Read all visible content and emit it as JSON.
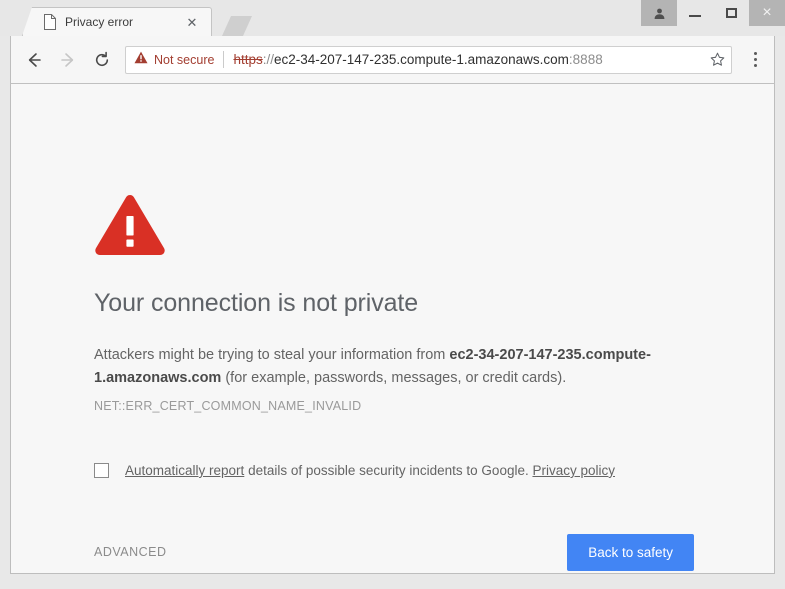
{
  "window": {
    "controls": {
      "avatar_label": "profile-avatar",
      "minimize_label": "Minimize",
      "maximize_label": "Maximize",
      "close_label": "×"
    }
  },
  "tabstrip": {
    "tabs": [
      {
        "title": "Privacy error",
        "favicon": "page-icon",
        "close_label": "✕"
      }
    ],
    "new_tab_label": "New tab"
  },
  "toolbar": {
    "back_label": "Back",
    "forward_label": "Forward",
    "reload_label": "Reload",
    "security": {
      "icon": "warning-triangle-icon",
      "label": "Not secure"
    },
    "url": {
      "scheme": "https",
      "separator": "://",
      "host": "ec2-34-207-147-235.compute-1.amazonaws.com",
      "port": ":8888",
      "full": "https://ec2-34-207-147-235.compute-1.amazonaws.com:8888"
    },
    "bookmark_label": "Bookmark this page",
    "menu_label": "Customize and control Google Chrome"
  },
  "page": {
    "icon": "error-warning-triangle-icon",
    "headline": "Your connection is not private",
    "body_prefix": "Attackers might be trying to steal your information from ",
    "body_domain": "ec2-34-207-147-235.compute-1.amazonaws.com",
    "body_suffix": " (for example, passwords, messages, or credit cards).",
    "error_code": "NET::ERR_CERT_COMMON_NAME_INVALID",
    "optout": {
      "checked": false,
      "link_text": "Automatically report",
      "middle_text": " details of possible security incidents to Google. ",
      "policy_link": "Privacy policy"
    },
    "advanced_label": "ADVANCED",
    "back_to_safety_label": "Back to safety"
  },
  "colors": {
    "danger_red": "#d93025",
    "accent_blue": "#4285f4",
    "not_secure_red": "#a33e31",
    "page_bg": "#f7f7f7"
  }
}
